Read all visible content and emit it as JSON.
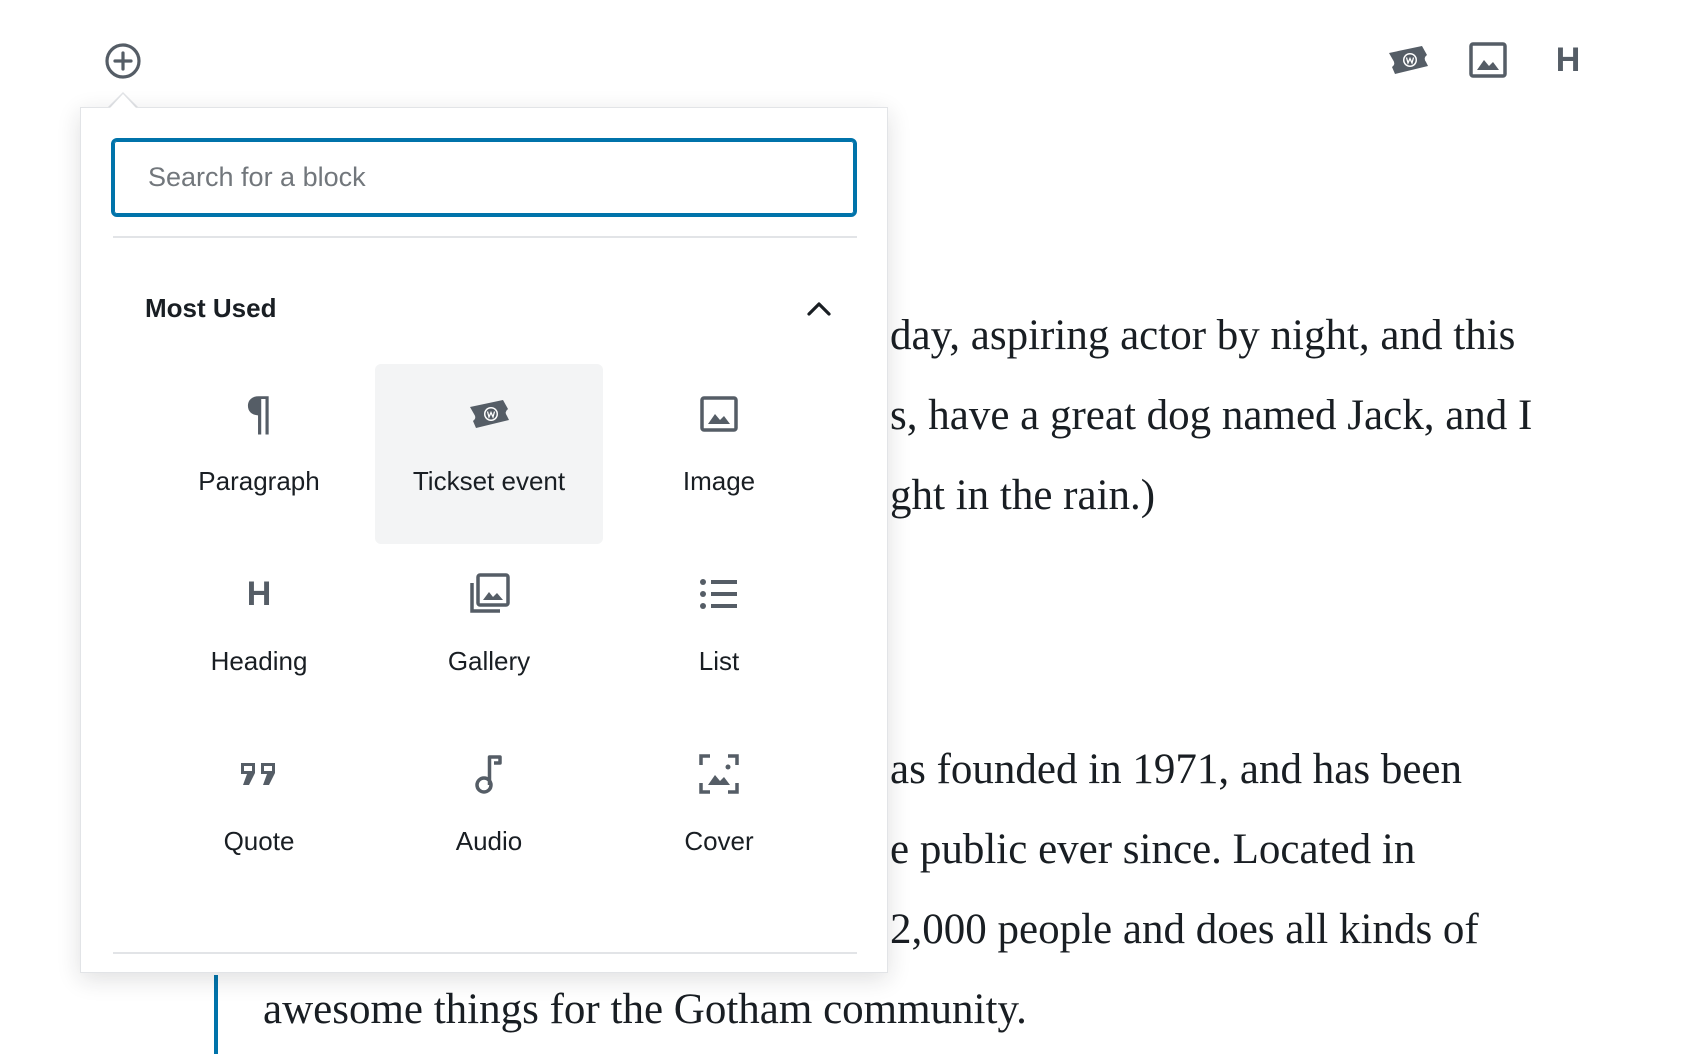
{
  "toolbar": {
    "items": [
      {
        "icon": "tickset-icon"
      },
      {
        "icon": "image-icon"
      },
      {
        "icon": "heading-icon",
        "glyph": "H"
      }
    ]
  },
  "inserter": {
    "toggle_icon": "plus-circle-icon",
    "search": {
      "placeholder": "Search for a block",
      "value": ""
    },
    "panel": {
      "title": "Most Used",
      "expanded": true,
      "blocks": [
        {
          "label": "Paragraph",
          "icon": "paragraph-icon",
          "active": false
        },
        {
          "label": "Tickset event",
          "icon": "tickset-icon",
          "active": true
        },
        {
          "label": "Image",
          "icon": "image-icon",
          "active": false
        },
        {
          "label": "Heading",
          "icon": "heading-icon",
          "active": false
        },
        {
          "label": "Gallery",
          "icon": "gallery-icon",
          "active": false
        },
        {
          "label": "List",
          "icon": "list-icon",
          "active": false
        },
        {
          "label": "Quote",
          "icon": "quote-icon",
          "active": false
        },
        {
          "label": "Audio",
          "icon": "audio-icon",
          "active": false
        },
        {
          "label": "Cover",
          "icon": "cover-icon",
          "active": false
        }
      ]
    }
  },
  "content": {
    "paragraph1": [
      "day, aspiring actor by night, and this",
      "s, have a great dog named Jack, and I",
      "ght in the rain.)"
    ],
    "paragraph2": [
      "as founded in 1971, and has been",
      "e public ever since. Located in",
      "2,000 people and does all kinds of",
      "awesome things for the Gotham community."
    ]
  },
  "colors": {
    "accent": "#0073aa",
    "icon": "#555d66",
    "text": "#191e23",
    "active_bg": "#f3f4f5",
    "border": "#e2e4e7"
  }
}
